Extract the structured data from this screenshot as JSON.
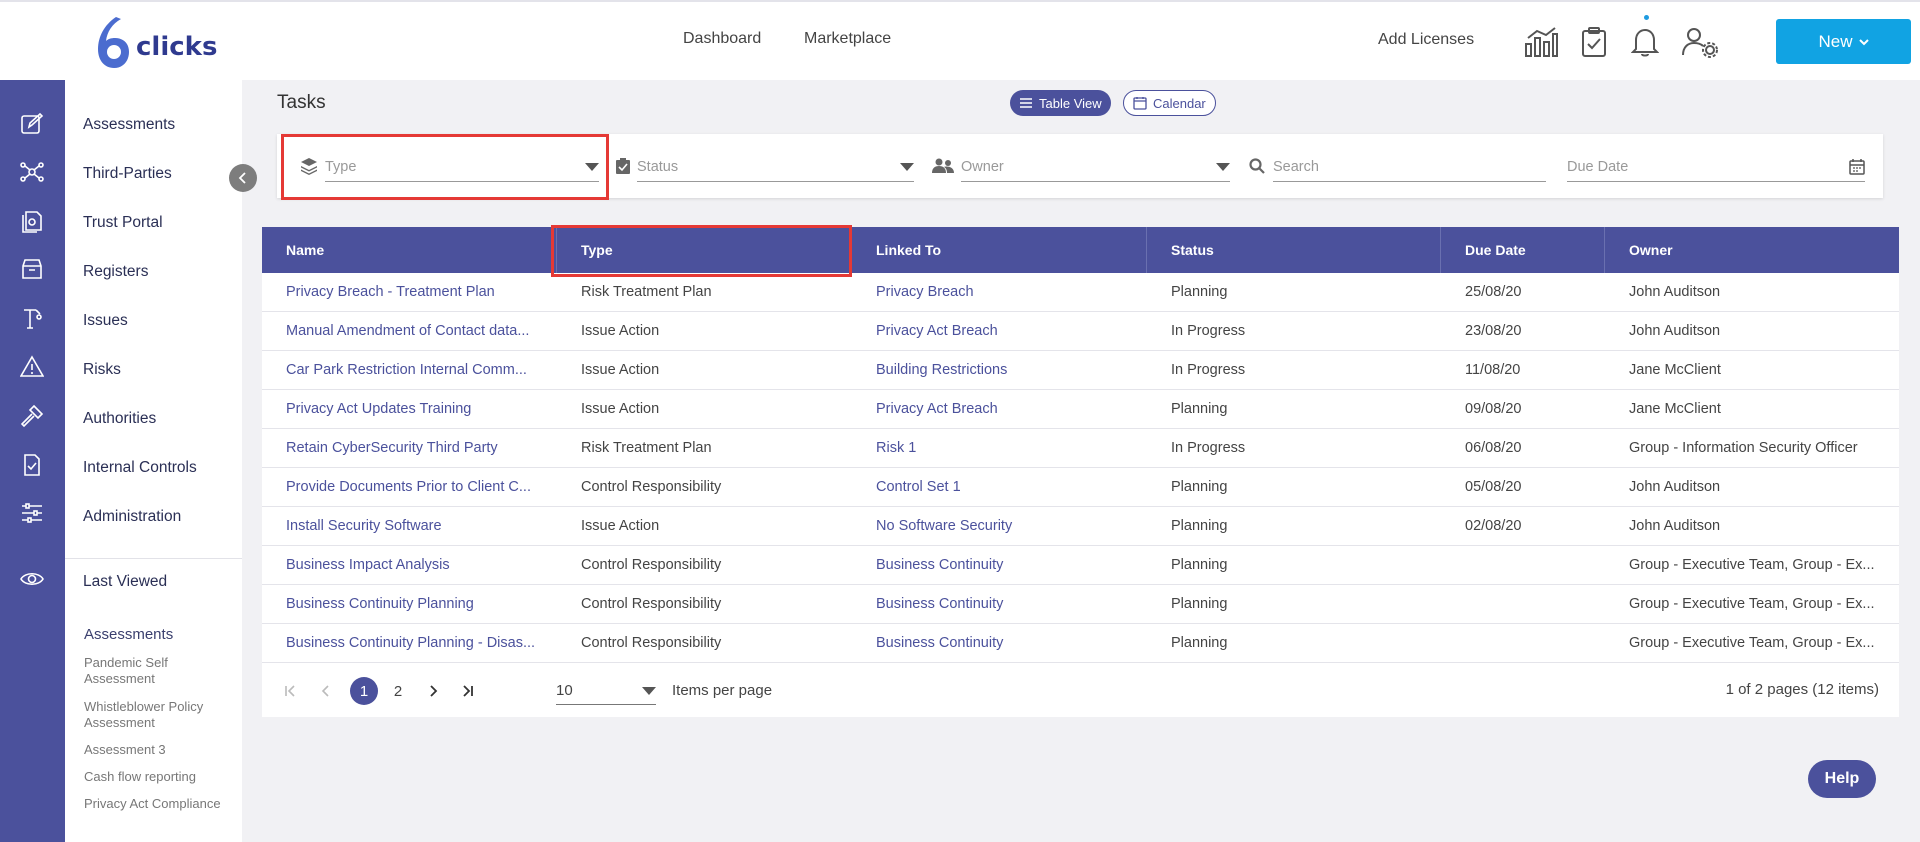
{
  "app": {
    "logo_text": "clicks"
  },
  "header": {
    "nav": [
      "Dashboard",
      "Marketplace"
    ],
    "add_licenses": "Add Licenses",
    "new_button": "New",
    "icons": [
      "chart-icon",
      "clipboard-check-icon",
      "bell-icon",
      "user-settings-icon"
    ]
  },
  "rail": {
    "icons": [
      "edit-icon",
      "network-icon",
      "documents-icon",
      "register-icon",
      "issue-icon",
      "warning-icon",
      "hammer-icon",
      "checklist-icon",
      "sliders-icon",
      "eye-icon"
    ]
  },
  "sidebar": {
    "items": [
      "Assessments",
      "Third-Parties",
      "Trust Portal",
      "Registers",
      "Issues",
      "Risks",
      "Authorities",
      "Internal Controls",
      "Administration"
    ],
    "last_viewed": "Last Viewed",
    "recent_section": "Assessments",
    "recent_items": [
      "Pandemic Self Assessment",
      "Whistleblower Policy Assessment",
      "Assessment 3",
      "Cash flow reporting",
      "Privacy Act Compliance"
    ]
  },
  "page": {
    "title": "Tasks",
    "view_table": "Table View",
    "view_calendar": "Calendar"
  },
  "filters": {
    "type": "Type",
    "status": "Status",
    "owner": "Owner",
    "search": "Search",
    "due_date": "Due Date"
  },
  "table": {
    "columns": [
      "Name",
      "Type",
      "Linked To",
      "Status",
      "Due Date",
      "Owner"
    ],
    "rows": [
      [
        "Privacy Breach - Treatment Plan",
        "Risk Treatment Plan",
        "Privacy Breach",
        "Planning",
        "25/08/20",
        "John Auditson"
      ],
      [
        "Manual Amendment of Contact data...",
        "Issue Action",
        "Privacy Act Breach",
        "In Progress",
        "23/08/20",
        "John Auditson"
      ],
      [
        "Car Park Restriction Internal Comm...",
        "Issue Action",
        "Building Restrictions",
        "In Progress",
        "11/08/20",
        "Jane McClient"
      ],
      [
        "Privacy Act Updates Training",
        "Issue Action",
        "Privacy Act Breach",
        "Planning",
        "09/08/20",
        "Jane McClient"
      ],
      [
        "Retain CyberSecurity Third Party",
        "Risk Treatment Plan",
        "Risk 1",
        "In Progress",
        "06/08/20",
        "Group - Information Security Officer"
      ],
      [
        "Provide Documents Prior to Client C...",
        "Control Responsibility",
        "Control Set 1",
        "Planning",
        "05/08/20",
        "John Auditson"
      ],
      [
        "Install Security Software",
        "Issue Action",
        "No Software Security",
        "Planning",
        "02/08/20",
        "John Auditson"
      ],
      [
        "Business Impact Analysis",
        "Control Responsibility",
        "Business Continuity",
        "Planning",
        "",
        "Group - Executive Team, Group - Ex..."
      ],
      [
        "Business Continuity Planning",
        "Control Responsibility",
        "Business Continuity",
        "Planning",
        "",
        "Group - Executive Team, Group - Ex..."
      ],
      [
        "Business Continuity Planning - Disas...",
        "Control Responsibility",
        "Business Continuity",
        "Planning",
        "",
        "Group - Executive Team, Group - Ex..."
      ]
    ]
  },
  "pagination": {
    "pages": [
      "1",
      "2"
    ],
    "current": "1",
    "per_page": "10",
    "per_page_label": "Items per page",
    "info": "1 of 2 pages (12 items)"
  },
  "help": "Help",
  "colors": {
    "primary": "#4b519c",
    "accent": "#11a3e3",
    "highlight": "#e53935"
  }
}
